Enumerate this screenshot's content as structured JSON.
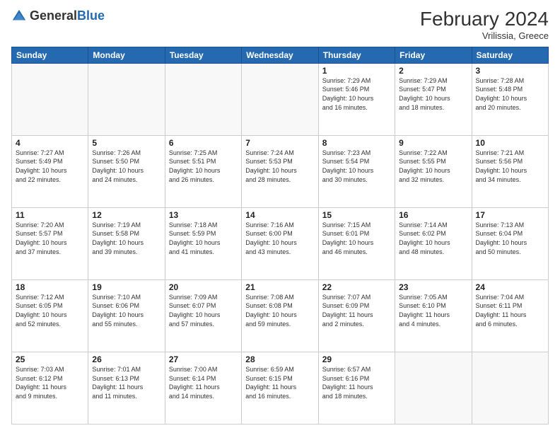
{
  "header": {
    "logo_line1": "General",
    "logo_line2": "Blue",
    "month_title": "February 2024",
    "location": "Vrilissia, Greece"
  },
  "weekdays": [
    "Sunday",
    "Monday",
    "Tuesday",
    "Wednesday",
    "Thursday",
    "Friday",
    "Saturday"
  ],
  "weeks": [
    [
      {
        "day": "",
        "info": ""
      },
      {
        "day": "",
        "info": ""
      },
      {
        "day": "",
        "info": ""
      },
      {
        "day": "",
        "info": ""
      },
      {
        "day": "1",
        "info": "Sunrise: 7:29 AM\nSunset: 5:46 PM\nDaylight: 10 hours\nand 16 minutes."
      },
      {
        "day": "2",
        "info": "Sunrise: 7:29 AM\nSunset: 5:47 PM\nDaylight: 10 hours\nand 18 minutes."
      },
      {
        "day": "3",
        "info": "Sunrise: 7:28 AM\nSunset: 5:48 PM\nDaylight: 10 hours\nand 20 minutes."
      }
    ],
    [
      {
        "day": "4",
        "info": "Sunrise: 7:27 AM\nSunset: 5:49 PM\nDaylight: 10 hours\nand 22 minutes."
      },
      {
        "day": "5",
        "info": "Sunrise: 7:26 AM\nSunset: 5:50 PM\nDaylight: 10 hours\nand 24 minutes."
      },
      {
        "day": "6",
        "info": "Sunrise: 7:25 AM\nSunset: 5:51 PM\nDaylight: 10 hours\nand 26 minutes."
      },
      {
        "day": "7",
        "info": "Sunrise: 7:24 AM\nSunset: 5:53 PM\nDaylight: 10 hours\nand 28 minutes."
      },
      {
        "day": "8",
        "info": "Sunrise: 7:23 AM\nSunset: 5:54 PM\nDaylight: 10 hours\nand 30 minutes."
      },
      {
        "day": "9",
        "info": "Sunrise: 7:22 AM\nSunset: 5:55 PM\nDaylight: 10 hours\nand 32 minutes."
      },
      {
        "day": "10",
        "info": "Sunrise: 7:21 AM\nSunset: 5:56 PM\nDaylight: 10 hours\nand 34 minutes."
      }
    ],
    [
      {
        "day": "11",
        "info": "Sunrise: 7:20 AM\nSunset: 5:57 PM\nDaylight: 10 hours\nand 37 minutes."
      },
      {
        "day": "12",
        "info": "Sunrise: 7:19 AM\nSunset: 5:58 PM\nDaylight: 10 hours\nand 39 minutes."
      },
      {
        "day": "13",
        "info": "Sunrise: 7:18 AM\nSunset: 5:59 PM\nDaylight: 10 hours\nand 41 minutes."
      },
      {
        "day": "14",
        "info": "Sunrise: 7:16 AM\nSunset: 6:00 PM\nDaylight: 10 hours\nand 43 minutes."
      },
      {
        "day": "15",
        "info": "Sunrise: 7:15 AM\nSunset: 6:01 PM\nDaylight: 10 hours\nand 46 minutes."
      },
      {
        "day": "16",
        "info": "Sunrise: 7:14 AM\nSunset: 6:02 PM\nDaylight: 10 hours\nand 48 minutes."
      },
      {
        "day": "17",
        "info": "Sunrise: 7:13 AM\nSunset: 6:04 PM\nDaylight: 10 hours\nand 50 minutes."
      }
    ],
    [
      {
        "day": "18",
        "info": "Sunrise: 7:12 AM\nSunset: 6:05 PM\nDaylight: 10 hours\nand 52 minutes."
      },
      {
        "day": "19",
        "info": "Sunrise: 7:10 AM\nSunset: 6:06 PM\nDaylight: 10 hours\nand 55 minutes."
      },
      {
        "day": "20",
        "info": "Sunrise: 7:09 AM\nSunset: 6:07 PM\nDaylight: 10 hours\nand 57 minutes."
      },
      {
        "day": "21",
        "info": "Sunrise: 7:08 AM\nSunset: 6:08 PM\nDaylight: 10 hours\nand 59 minutes."
      },
      {
        "day": "22",
        "info": "Sunrise: 7:07 AM\nSunset: 6:09 PM\nDaylight: 11 hours\nand 2 minutes."
      },
      {
        "day": "23",
        "info": "Sunrise: 7:05 AM\nSunset: 6:10 PM\nDaylight: 11 hours\nand 4 minutes."
      },
      {
        "day": "24",
        "info": "Sunrise: 7:04 AM\nSunset: 6:11 PM\nDaylight: 11 hours\nand 6 minutes."
      }
    ],
    [
      {
        "day": "25",
        "info": "Sunrise: 7:03 AM\nSunset: 6:12 PM\nDaylight: 11 hours\nand 9 minutes."
      },
      {
        "day": "26",
        "info": "Sunrise: 7:01 AM\nSunset: 6:13 PM\nDaylight: 11 hours\nand 11 minutes."
      },
      {
        "day": "27",
        "info": "Sunrise: 7:00 AM\nSunset: 6:14 PM\nDaylight: 11 hours\nand 14 minutes."
      },
      {
        "day": "28",
        "info": "Sunrise: 6:59 AM\nSunset: 6:15 PM\nDaylight: 11 hours\nand 16 minutes."
      },
      {
        "day": "29",
        "info": "Sunrise: 6:57 AM\nSunset: 6:16 PM\nDaylight: 11 hours\nand 18 minutes."
      },
      {
        "day": "",
        "info": ""
      },
      {
        "day": "",
        "info": ""
      }
    ]
  ]
}
